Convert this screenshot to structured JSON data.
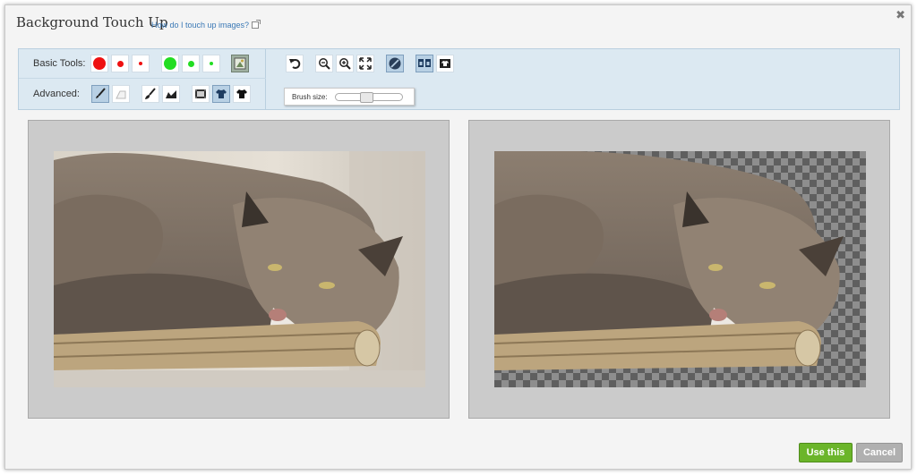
{
  "dialog": {
    "title": "Background Touch Up",
    "help_link": "How do I touch up images?",
    "close_glyph": "✖"
  },
  "toolbar": {
    "basic_label": "Basic Tools:",
    "advanced_label": "Advanced:",
    "brush_size_label": "Brush size:",
    "brush_size_fraction": 0.45,
    "colors": {
      "red": "#ee1111",
      "green": "#22dd22",
      "accent": "#b8d0e4"
    }
  },
  "basic_tools": [
    {
      "name": "red-large-brush-icon",
      "color": "#ee1111",
      "size": 14
    },
    {
      "name": "red-medium-brush-icon",
      "color": "#ee1111",
      "size": 8
    },
    {
      "name": "red-small-brush-icon",
      "color": "#ee1111",
      "size": 4
    },
    {
      "name": "green-large-brush-icon",
      "color": "#22dd22",
      "size": 14
    },
    {
      "name": "green-medium-brush-icon",
      "color": "#22dd22",
      "size": 8
    },
    {
      "name": "green-small-brush-icon",
      "color": "#22dd22",
      "size": 4
    }
  ],
  "buttons": {
    "use_this": "Use this",
    "cancel": "Cancel"
  }
}
